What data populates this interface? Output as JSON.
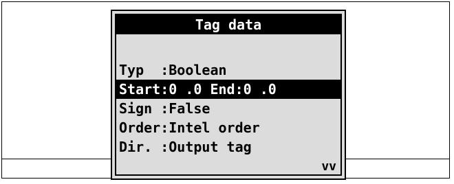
{
  "screen": {
    "title": "Tag data",
    "rows": [
      {
        "label": "Typ  :",
        "value": "Boolean"
      },
      {
        "label": "Start:",
        "value": "0 .0 End:0 .0"
      },
      {
        "label": "Sign :",
        "value": "False"
      },
      {
        "label": "Order:",
        "value": "Intel order"
      },
      {
        "label": "Dir. :",
        "value": "Output tag"
      }
    ],
    "selected_row": "Start",
    "scroll_indicator": "vv"
  },
  "colors": {
    "screen_bg": "#dcdcdc",
    "highlight_bg": "#000000",
    "highlight_fg": "#ffffff",
    "text": "#000000"
  }
}
